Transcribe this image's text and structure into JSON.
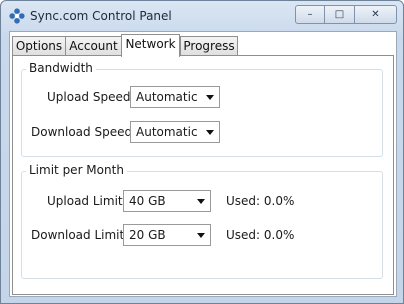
{
  "window": {
    "title": "Sync.com Control Panel",
    "controls": {
      "minimize": "–",
      "maximize": "□",
      "close": "✕"
    }
  },
  "tabs": [
    {
      "label": "Options",
      "active": false
    },
    {
      "label": "Account",
      "active": false
    },
    {
      "label": "Network",
      "active": true
    },
    {
      "label": "Progress",
      "active": false
    }
  ],
  "bandwidth": {
    "title": "Bandwidth",
    "upload_label": "Upload Speed",
    "upload_value": "Automatic",
    "download_label": "Download Speed",
    "download_value": "Automatic"
  },
  "limits": {
    "title": "Limit per Month",
    "upload_label": "Upload Limit",
    "upload_value": "40 GB",
    "upload_used": "Used: 0.0%",
    "download_label": "Download Limit",
    "download_value": "20 GB",
    "download_used": "Used: 0.0%"
  },
  "colors": {
    "titlebar": "#c9d9ec",
    "brand_icon": "#2f6db5"
  },
  "icons": {
    "app": "sync-logo-icon",
    "dropdown": "chevron-down-icon"
  }
}
